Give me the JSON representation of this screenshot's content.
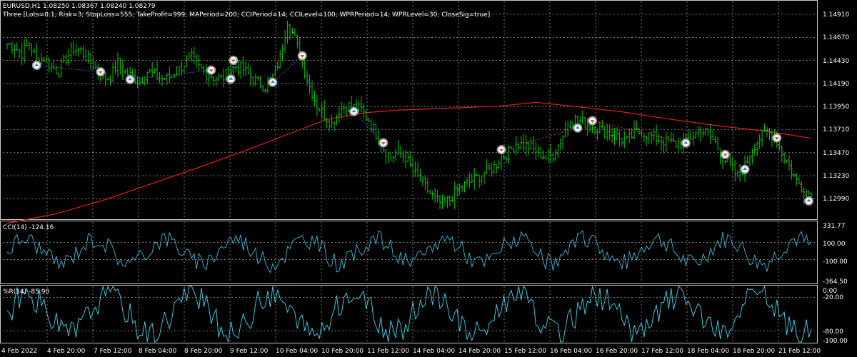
{
  "header": {
    "symbol_line": "EURUSD,H1  1.08250 1.08367 1.08240 1.08279",
    "ea_line": "Three [Lots=0.1; Risk=3; StopLoss=555; TakeProfit=999; MAPeriod=200; CCIPeriod=14; CCILevel=100; WPRPeriod=14; WPRLevel=30; CloseSig=true]"
  },
  "colors": {
    "background": "#000000",
    "grid": "#c8c8c8",
    "frame": "#c8c8c8",
    "candle_bull": "#00c800",
    "ma_line": "#e02020",
    "cci_line": "#3fb8d8",
    "wpr_line": "#3fd8f0",
    "buy_marker": "#2a7fd4",
    "sell_marker": "#e05030"
  },
  "main_axis": {
    "labels": [
      "1.14910",
      "1.14670",
      "1.14430",
      "1.14190",
      "1.13950",
      "1.13710",
      "1.13470",
      "1.13230",
      "1.12990"
    ]
  },
  "cci": {
    "title": "CCI(14) -124.16",
    "axis_labels": [
      "331.77",
      "100.00",
      "-100.00",
      "-364.50"
    ]
  },
  "wpr": {
    "title": "%R(14) -85.90",
    "axis_labels": [
      "0.00",
      "-20.00",
      "-80.00",
      "-100.00"
    ]
  },
  "time_axis": {
    "labels": [
      "4 Feb 2022",
      "4 Feb 20:00",
      "7 Feb 12:00",
      "8 Feb 04:00",
      "8 Feb 20:00",
      "9 Feb 12:00",
      "10 Feb 04:00",
      "10 Feb 20:00",
      "11 Feb 12:00",
      "14 Feb 04:00",
      "14 Feb 20:00",
      "15 Feb 12:00",
      "16 Feb 04:00",
      "16 Feb 20:00",
      "17 Feb 12:00",
      "18 Feb 04:00",
      "18 Feb 20:00",
      "21 Feb 12:00"
    ]
  },
  "chart_data": {
    "type": "candlestick",
    "price_range": [
      1.128,
      1.151
    ],
    "series": [
      {
        "name": "EURUSD,H1",
        "points": [
          [
            0,
            1.1465
          ],
          [
            3,
            1.1462
          ],
          [
            6,
            1.1455
          ],
          [
            9,
            1.1466
          ],
          [
            12,
            1.1448
          ],
          [
            15,
            1.145
          ],
          [
            18,
            1.144
          ],
          [
            21,
            1.1436
          ],
          [
            24,
            1.145
          ],
          [
            27,
            1.146
          ],
          [
            30,
            1.1458
          ],
          [
            33,
            1.1448
          ],
          [
            36,
            1.144
          ],
          [
            39,
            1.1428
          ],
          [
            42,
            1.143
          ],
          [
            45,
            1.1445
          ],
          [
            48,
            1.1435
          ],
          [
            51,
            1.143
          ],
          [
            54,
            1.1425
          ],
          [
            57,
            1.1436
          ],
          [
            60,
            1.1432
          ],
          [
            63,
            1.1428
          ],
          [
            66,
            1.143
          ],
          [
            69,
            1.1436
          ],
          [
            72,
            1.1444
          ],
          [
            75,
            1.145
          ],
          [
            78,
            1.144
          ],
          [
            81,
            1.1434
          ],
          [
            84,
            1.143
          ],
          [
            87,
            1.1428
          ],
          [
            90,
            1.1435
          ],
          [
            93,
            1.1441
          ],
          [
            96,
            1.1438
          ],
          [
            99,
            1.143
          ],
          [
            102,
            1.1424
          ],
          [
            105,
            1.142
          ],
          [
            108,
            1.143
          ],
          [
            111,
            1.145
          ],
          [
            114,
            1.149
          ],
          [
            117,
            1.147
          ],
          [
            120,
            1.1445
          ],
          [
            123,
            1.142
          ],
          [
            126,
            1.14
          ],
          [
            129,
            1.139
          ],
          [
            132,
            1.138
          ],
          [
            135,
            1.1395
          ],
          [
            138,
            1.14
          ],
          [
            141,
            1.1398
          ],
          [
            144,
            1.1395
          ],
          [
            147,
            1.1385
          ],
          [
            150,
            1.137
          ],
          [
            153,
            1.1355
          ],
          [
            156,
            1.1345
          ],
          [
            159,
            1.135
          ],
          [
            162,
            1.1345
          ],
          [
            165,
            1.133
          ],
          [
            168,
            1.132
          ],
          [
            171,
            1.131
          ],
          [
            174,
            1.13
          ],
          [
            177,
            1.1295
          ],
          [
            180,
            1.13
          ],
          [
            183,
            1.131
          ],
          [
            186,
            1.1315
          ],
          [
            189,
            1.132
          ],
          [
            192,
            1.1325
          ],
          [
            195,
            1.133
          ],
          [
            198,
            1.1335
          ],
          [
            201,
            1.1345
          ],
          [
            204,
            1.135
          ],
          [
            207,
            1.136
          ],
          [
            210,
            1.1358
          ],
          [
            213,
            1.1355
          ],
          [
            216,
            1.135
          ],
          [
            219,
            1.1345
          ],
          [
            222,
            1.1348
          ],
          [
            225,
            1.1362
          ],
          [
            228,
            1.138
          ],
          [
            231,
            1.1385
          ],
          [
            234,
            1.1382
          ],
          [
            237,
            1.1378
          ],
          [
            240,
            1.1376
          ],
          [
            243,
            1.1372
          ],
          [
            246,
            1.137
          ],
          [
            249,
            1.1365
          ],
          [
            252,
            1.1362
          ],
          [
            255,
            1.137
          ],
          [
            258,
            1.1372
          ],
          [
            261,
            1.1368
          ],
          [
            264,
            1.1365
          ],
          [
            267,
            1.1362
          ],
          [
            270,
            1.136
          ],
          [
            273,
            1.1358
          ],
          [
            276,
            1.1362
          ],
          [
            279,
            1.1368
          ],
          [
            282,
            1.1374
          ],
          [
            285,
            1.137
          ],
          [
            288,
            1.136
          ],
          [
            291,
            1.1345
          ],
          [
            294,
            1.1335
          ],
          [
            297,
            1.1325
          ],
          [
            300,
            1.1335
          ],
          [
            303,
            1.1355
          ],
          [
            306,
            1.1365
          ],
          [
            309,
            1.1372
          ],
          [
            312,
            1.1368
          ],
          [
            315,
            1.135
          ],
          [
            318,
            1.1335
          ],
          [
            321,
            1.132
          ],
          [
            324,
            1.131
          ],
          [
            327,
            1.1305
          ]
        ]
      },
      {
        "name": "MA(200)",
        "points": [
          [
            0,
            1.1275
          ],
          [
            20,
            1.1285
          ],
          [
            40,
            1.13
          ],
          [
            60,
            1.1318
          ],
          [
            80,
            1.1336
          ],
          [
            100,
            1.1355
          ],
          [
            115,
            1.137
          ],
          [
            130,
            1.1385
          ],
          [
            145,
            1.1392
          ],
          [
            160,
            1.1395
          ],
          [
            180,
            1.1397
          ],
          [
            200,
            1.1399
          ],
          [
            215,
            1.1403
          ],
          [
            230,
            1.1399
          ],
          [
            250,
            1.1393
          ],
          [
            270,
            1.1385
          ],
          [
            290,
            1.1378
          ],
          [
            310,
            1.1372
          ],
          [
            327,
            1.1365
          ]
        ]
      }
    ],
    "cci_range": [
      -364.5,
      331.77
    ],
    "cci_levels": [
      100,
      -100
    ],
    "wpr_range": [
      -100,
      0
    ],
    "wpr_levels": [
      -20,
      -80
    ]
  }
}
